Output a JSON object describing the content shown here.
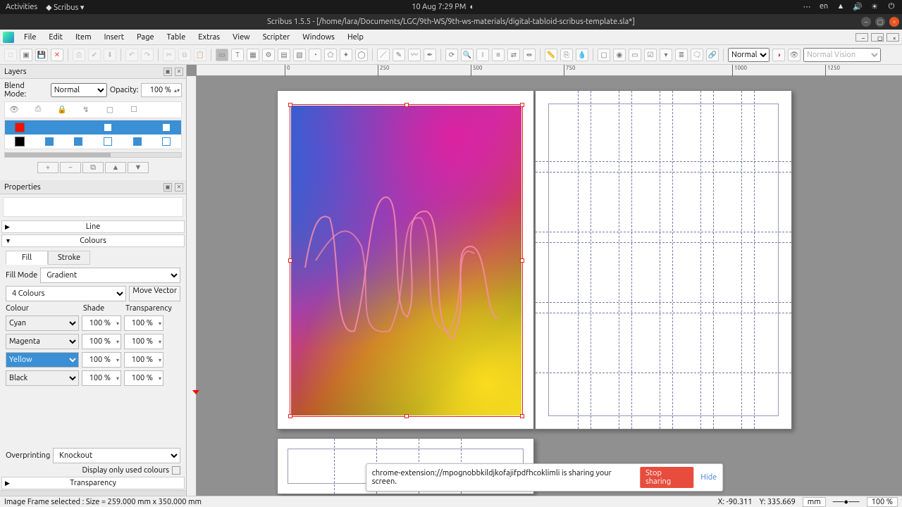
{
  "topbar": {
    "activities": "Activities",
    "app": "Scribus",
    "datetime": "10 Aug   7:29 PM",
    "lang": "en"
  },
  "titlebar": {
    "title": "Scribus 1.5.5 - [/home/lara/Documents/LGC/9th-WS/9th-ws-materials/digital-tabloid-scribus-template.sla*]"
  },
  "menus": [
    "File",
    "Edit",
    "Item",
    "Insert",
    "Page",
    "Table",
    "Extras",
    "View",
    "Scripter",
    "Windows",
    "Help"
  ],
  "toolbar": {
    "mode": "Normal",
    "vision": "Normal Vision"
  },
  "layers": {
    "title": "Layers",
    "blend_label": "Blend Mode:",
    "blend_value": "Normal",
    "opacity_label": "Opacity:",
    "opacity_value": "100 %",
    "rows": [
      {
        "color": "#e10",
        "checks": [
          true,
          true,
          false,
          true,
          false
        ]
      },
      {
        "color": "#000",
        "checks": [
          true,
          true,
          false,
          true,
          false
        ]
      }
    ]
  },
  "properties": {
    "title": "Properties",
    "sections": {
      "line": "Line",
      "colours": "Colours",
      "transparency": "Transparency"
    },
    "tabs": {
      "fill": "Fill",
      "stroke": "Stroke"
    },
    "fill_mode_label": "Fill Mode",
    "fill_mode_value": "Gradient",
    "grad_type": "4 Colours",
    "move_vector": "Move Vector",
    "col_headers": {
      "colour": "Colour",
      "shade": "Shade",
      "transparency": "Transparency"
    },
    "rows": [
      {
        "colour": "Cyan",
        "shade": "100 %",
        "trans": "100 %",
        "hl": false
      },
      {
        "colour": "Magenta",
        "shade": "100 %",
        "trans": "100 %",
        "hl": false
      },
      {
        "colour": "Yellow",
        "shade": "100 %",
        "trans": "100 %",
        "hl": true
      },
      {
        "colour": "Black",
        "shade": "100 %",
        "trans": "100 %",
        "hl": false
      }
    ],
    "overprint_label": "Overprinting",
    "overprint_value": "Knockout",
    "display_used": "Display only used colours"
  },
  "ruler_ticks": [
    "0",
    "250",
    "500",
    "750",
    "1000",
    "1250"
  ],
  "share": {
    "msg": "chrome-extension://mpognobbkildjkofajifpdfhcoklimli is sharing your screen.",
    "stop": "Stop sharing",
    "hide": "Hide"
  },
  "status": {
    "left": "Image Frame selected : Size = 259.000 mm x 350.000 mm",
    "x": "X: -90.311",
    "y": "Y: 335.669",
    "unit": "mm",
    "zoom": "100 %"
  }
}
